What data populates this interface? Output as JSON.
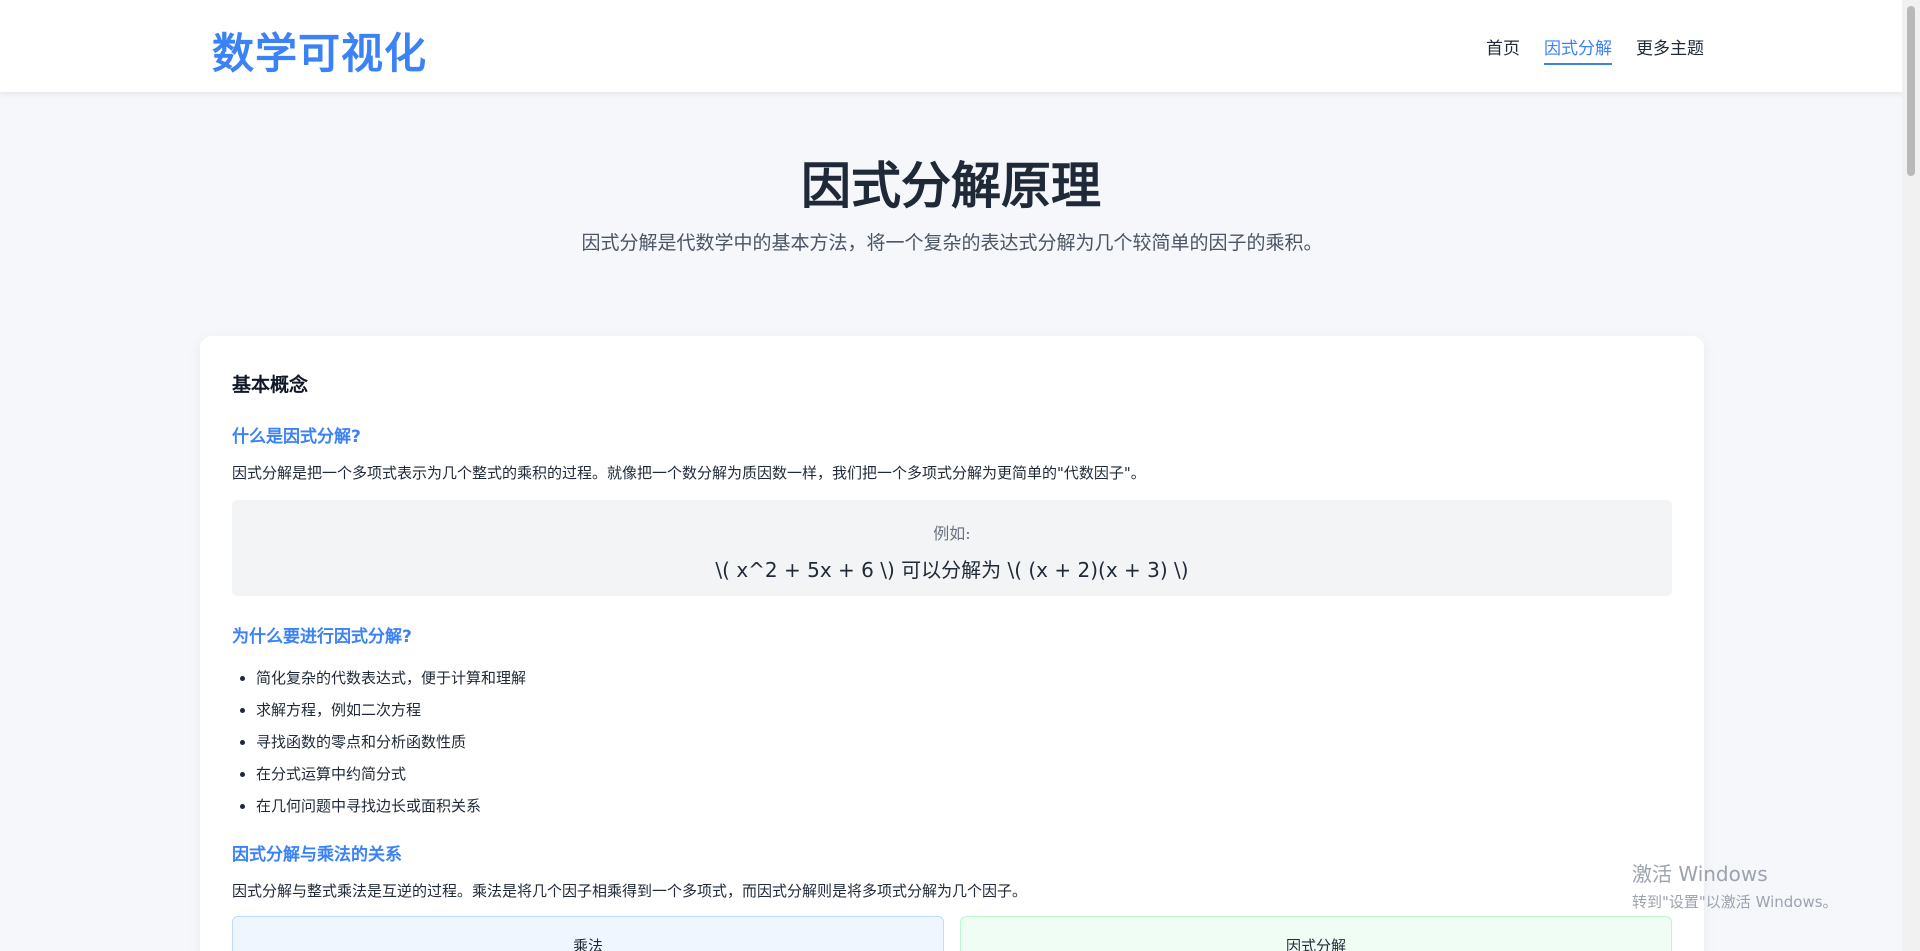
{
  "header": {
    "logo": "数学可视化",
    "nav": [
      "首页",
      "因式分解",
      "更多主题"
    ],
    "active_nav": "因式分解"
  },
  "hero": {
    "title": "因式分解原理",
    "description": "因式分解是代数学中的基本方法，将一个复杂的表达式分解为几个较简单的因子的乘积。"
  },
  "card": {
    "title": "基本概念",
    "sections": {
      "what": {
        "title": "什么是因式分解?",
        "text": "因式分解是把一个多项式表示为几个整式的乘积的过程。就像把一个数分解为质因数一样，我们把一个多项式分解为更简单的\"代数因子\"。"
      },
      "example": {
        "label": "例如:",
        "formula": "\\( x^2 + 5x + 6 \\) 可以分解为 \\( (x + 2)(x + 3) \\)"
      },
      "why": {
        "title": "为什么要进行因式分解?",
        "items": [
          "简化复杂的代数表达式，便于计算和理解",
          "求解方程，例如二次方程",
          "寻找函数的零点和分析函数性质",
          "在分式运算中约简分式",
          "在几何问题中寻找边长或面积关系"
        ]
      },
      "relation": {
        "title": "因式分解与乘法的关系",
        "text": "因式分解与整式乘法是互逆的过程。乘法是将几个因子相乘得到一个多项式，而因式分解则是将多项式分解为几个因子。",
        "multiply_label": "乘法",
        "factor_label": "因式分解"
      }
    }
  },
  "watermark": {
    "line1": "激活 Windows",
    "line2": "转到\"设置\"以激活 Windows。"
  }
}
